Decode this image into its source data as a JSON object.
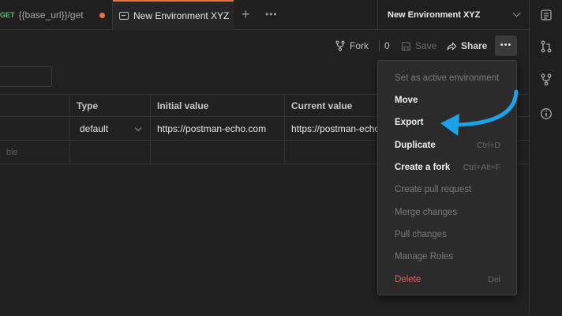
{
  "tabs": [
    {
      "method": "GET",
      "label": "{{base_url}}/get",
      "unsaved": true
    },
    {
      "label": "New Environment XYZ",
      "active": true
    }
  ],
  "tab_plus": "+",
  "tab_more": "•••",
  "environment_selector": {
    "selected": "New Environment XYZ"
  },
  "toolbar": {
    "fork_label": "Fork",
    "fork_count": "0",
    "save_label": "Save",
    "share_label": "Share",
    "more_label": "•••"
  },
  "table": {
    "headers": [
      "",
      "Type",
      "Initial value",
      "Current value"
    ],
    "rows": [
      {
        "variable": "",
        "type": "default",
        "initial": "https://postman-echo.com",
        "current": "https://postman-echo"
      }
    ],
    "new_row_placeholder": "ble"
  },
  "menu": {
    "items": [
      {
        "label": "Set as active environment",
        "state": "disabled",
        "shortcut": ""
      },
      {
        "label": "Move",
        "state": "enabled",
        "shortcut": ""
      },
      {
        "label": "Export",
        "state": "enabled",
        "shortcut": ""
      },
      {
        "label": "Duplicate",
        "state": "enabled",
        "shortcut": "Ctrl+D"
      },
      {
        "label": "Create a fork",
        "state": "enabled",
        "shortcut": "Ctrl+Alt+F"
      },
      {
        "label": "Create pull request",
        "state": "disabled",
        "shortcut": ""
      },
      {
        "label": "Merge changes",
        "state": "disabled",
        "shortcut": ""
      },
      {
        "label": "Pull changes",
        "state": "disabled",
        "shortcut": ""
      },
      {
        "label": "Manage Roles",
        "state": "disabled",
        "shortcut": ""
      },
      {
        "label": "Delete",
        "state": "danger",
        "shortcut": "Del"
      }
    ]
  },
  "colors": {
    "accent": "#e8743b",
    "get_method": "#5ac26d",
    "annotation_arrow": "#1aa3e8",
    "danger": "#ef5b5b"
  },
  "icons": [
    "environment-icon",
    "fork-icon",
    "save-icon",
    "share-icon",
    "chevron-down-icon",
    "pull-request-icon",
    "branch-icon",
    "info-icon",
    "environment-quicklook-icon"
  ]
}
